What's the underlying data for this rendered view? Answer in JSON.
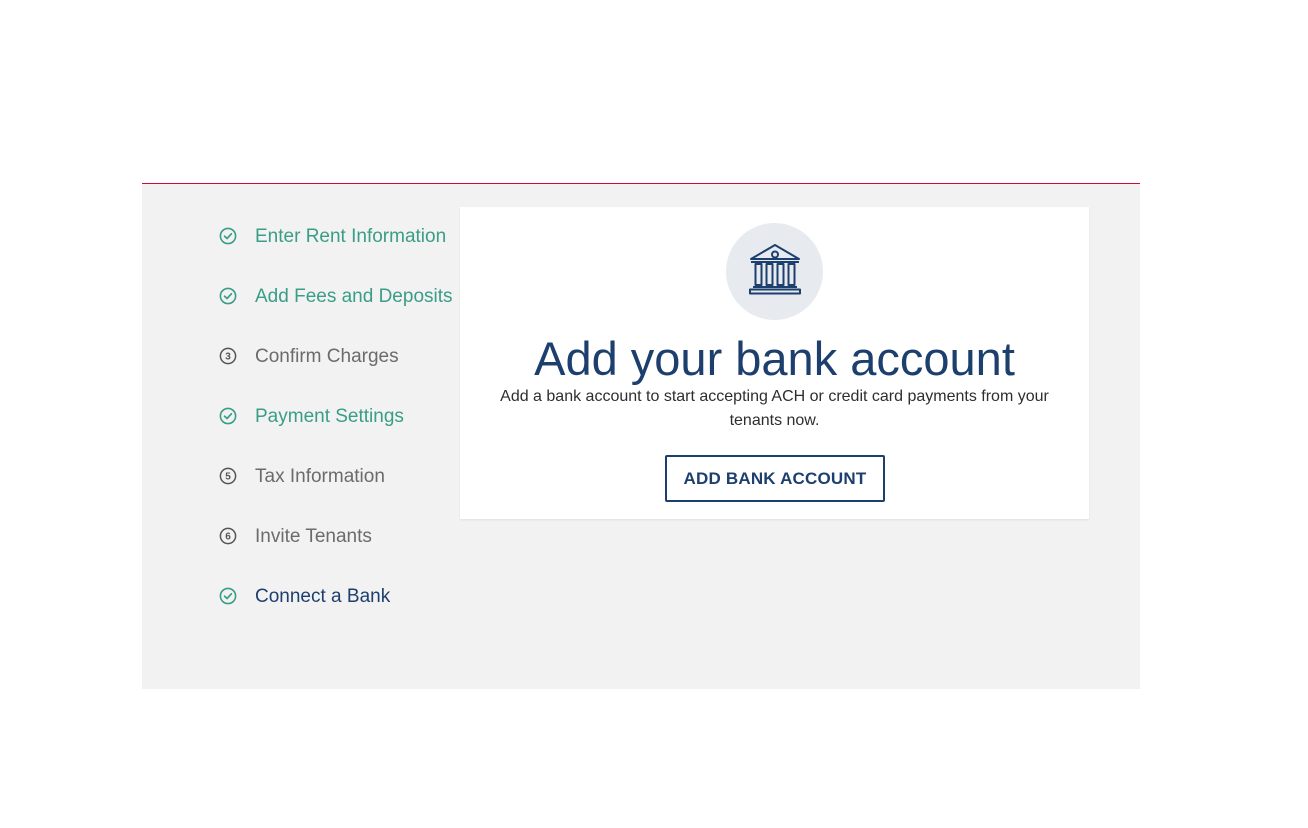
{
  "steps": [
    {
      "label": "Enter Rent Information",
      "state": "complete",
      "number": ""
    },
    {
      "label": "Add Fees and Deposits",
      "state": "complete",
      "number": ""
    },
    {
      "label": "Confirm Charges",
      "state": "pending",
      "number": "3"
    },
    {
      "label": "Payment Settings",
      "state": "complete",
      "number": ""
    },
    {
      "label": "Tax Information",
      "state": "pending",
      "number": "5"
    },
    {
      "label": "Invite Tenants",
      "state": "pending",
      "number": "6"
    },
    {
      "label": "Connect a Bank",
      "state": "current",
      "number": ""
    }
  ],
  "card": {
    "icon": "bank-icon",
    "title": "Add your bank account",
    "description": "Add a bank account to start accepting ACH or credit card payments from your tenants now.",
    "button_label": "ADD BANK ACCOUNT"
  },
  "colors": {
    "accent_red": "#c8102e",
    "complete_green": "#3a9d86",
    "navy": "#1d3f6e",
    "pending_gray": "#6b6b6b",
    "panel_bg": "#f2f2f2",
    "icon_circle_bg": "#e7ebf0"
  }
}
